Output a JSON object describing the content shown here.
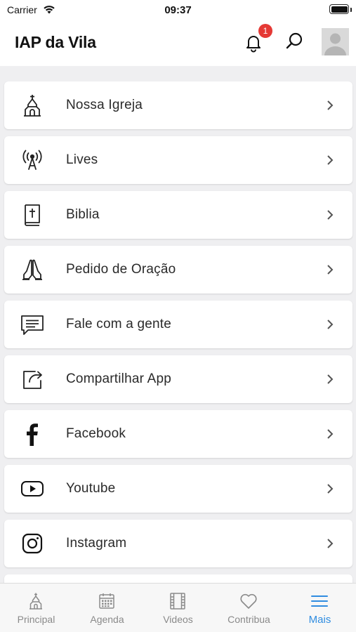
{
  "status_bar": {
    "carrier": "Carrier",
    "time": "09:37"
  },
  "header": {
    "title": "IAP da Vila",
    "notification_count": "1"
  },
  "menu": [
    {
      "label": "Nossa Igreja",
      "icon": "church-icon"
    },
    {
      "label": "Lives",
      "icon": "broadcast-icon"
    },
    {
      "label": "Biblia",
      "icon": "bible-icon"
    },
    {
      "label": "Pedido de Oração",
      "icon": "praying-hands-icon"
    },
    {
      "label": "Fale com a gente",
      "icon": "chat-icon"
    },
    {
      "label": "Compartilhar App",
      "icon": "share-icon"
    },
    {
      "label": "Facebook",
      "icon": "facebook-icon"
    },
    {
      "label": "Youtube",
      "icon": "youtube-icon"
    },
    {
      "label": "Instagram",
      "icon": "instagram-icon"
    }
  ],
  "tabs": [
    {
      "label": "Principal",
      "icon": "church-icon"
    },
    {
      "label": "Agenda",
      "icon": "calendar-icon"
    },
    {
      "label": "Videos",
      "icon": "film-icon"
    },
    {
      "label": "Contribua",
      "icon": "heart-icon"
    },
    {
      "label": "Mais",
      "icon": "menu-icon",
      "active": true
    }
  ],
  "colors": {
    "accent": "#2f8ce0",
    "badge": "#e53935",
    "background": "#efeff1"
  }
}
